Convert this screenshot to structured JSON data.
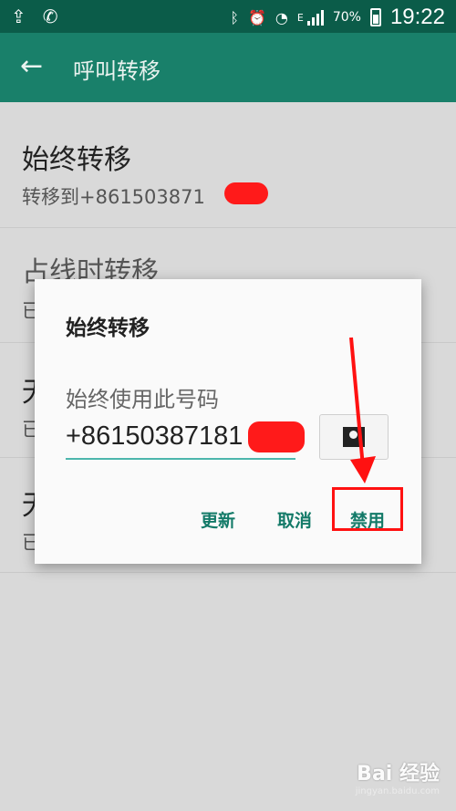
{
  "status_bar": {
    "battery": "70%",
    "network": "E",
    "time": "19:22",
    "icons": [
      "upload-icon",
      "call-forward-icon",
      "bluetooth-icon",
      "alarm-icon",
      "wifi-icon",
      "signal-icon",
      "battery-icon"
    ]
  },
  "app_bar": {
    "back_icon": "←",
    "title": "呼叫转移"
  },
  "list": {
    "items": [
      {
        "title": "始终转移",
        "subtitle": "转移到+861503871"
      },
      {
        "title": "占线时转移",
        "subtitle": "已"
      },
      {
        "title": "无",
        "subtitle": "已"
      },
      {
        "title": "无",
        "subtitle": "已"
      }
    ]
  },
  "dialog": {
    "title": "始终转移",
    "label": "始终使用此号码",
    "number": "+86150387181",
    "actions": {
      "update": "更新",
      "cancel": "取消",
      "disable": "禁用"
    }
  },
  "watermark": {
    "brand": "Bai 经验",
    "url": "jingyan.baidu.com"
  },
  "colors": {
    "status_bar": "#0b5c49",
    "app_bar": "#19806a",
    "accent": "#137a68",
    "annotation": "#ff1111"
  }
}
